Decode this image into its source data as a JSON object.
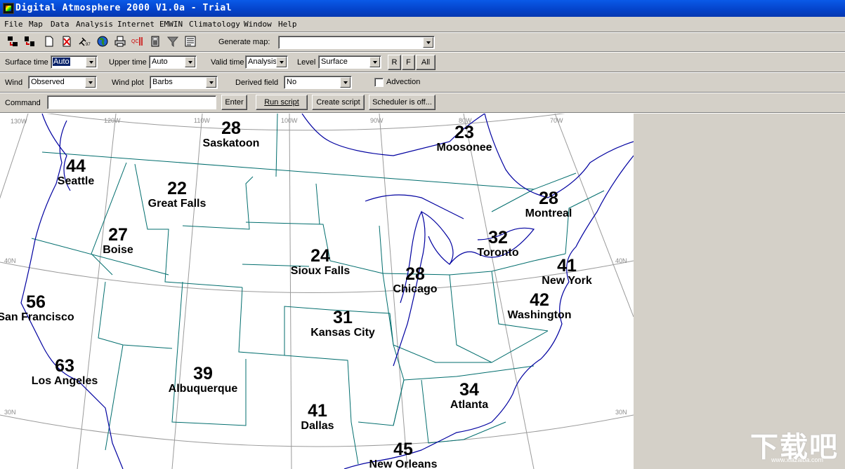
{
  "window": {
    "title": "Digital Atmosphere 2000 V1.0a - Trial"
  },
  "menu": [
    "File",
    "Map",
    "Data",
    "Analysis",
    "Internet",
    "EMWIN",
    "Climatology",
    "Window",
    "Help"
  ],
  "toolbar": {
    "icons": [
      "tile-horizontal-icon",
      "tile-vertical-icon",
      "new-map-icon",
      "delete-icon",
      "satellite-icon",
      "globe-icon",
      "print-icon",
      "radar-icon",
      "calculator-icon",
      "filter-icon",
      "report-icon"
    ],
    "generate_map_label": "Generate map:",
    "generate_map_value": ""
  },
  "row1": {
    "surface_time_label": "Surface time",
    "surface_time_value": "Auto",
    "upper_time_label": "Upper time",
    "upper_time_value": "Auto",
    "valid_time_label": "Valid time",
    "valid_time_value": "Analysis",
    "level_label": "Level",
    "level_value": "Surface",
    "btn_r": "R",
    "btn_f": "F",
    "btn_all": "All"
  },
  "row2": {
    "wind_label": "Wind",
    "wind_value": "Observed",
    "wind_plot_label": "Wind plot",
    "wind_plot_value": "Barbs",
    "derived_field_label": "Derived field",
    "derived_field_value": "No",
    "advection_label": "Advection",
    "advection_checked": false
  },
  "row3": {
    "command_label": "Command",
    "command_value": "",
    "enter_label": "Enter",
    "run_script_label": "Run script",
    "create_script_label": "Create script",
    "scheduler_label": "Scheduler is off..."
  },
  "map": {
    "colors": {
      "coast": "#0000a0",
      "state_border": "#006d6d",
      "grid": "#9a9a9a",
      "background": "#ffffff"
    },
    "longitudes": [
      "130W",
      "120W",
      "110W",
      "100W",
      "90W",
      "80W",
      "70W"
    ],
    "latitudes": [
      "40N",
      "40N",
      "30N",
      "30N"
    ],
    "cities": [
      {
        "name": "Saskatoon",
        "temp": "28"
      },
      {
        "name": "Moosonee",
        "temp": "23"
      },
      {
        "name": "Seattle",
        "temp": "44"
      },
      {
        "name": "Great Falls",
        "temp": "22"
      },
      {
        "name": "Montreal",
        "temp": "28"
      },
      {
        "name": "Boise",
        "temp": "27"
      },
      {
        "name": "Toronto",
        "temp": "32"
      },
      {
        "name": "Sioux Falls",
        "temp": "24"
      },
      {
        "name": "Chicago",
        "temp": "28"
      },
      {
        "name": "New York",
        "temp": "41"
      },
      {
        "name": "San Francisco",
        "temp": "56"
      },
      {
        "name": "Washington",
        "temp": "42"
      },
      {
        "name": "Kansas City",
        "temp": "31"
      },
      {
        "name": "Los Angeles",
        "temp": "63"
      },
      {
        "name": "Albuquerque",
        "temp": "39"
      },
      {
        "name": "Atlanta",
        "temp": "34"
      },
      {
        "name": "Dallas",
        "temp": "41"
      },
      {
        "name": "New Orleans",
        "temp": "45"
      }
    ]
  },
  "watermark": {
    "text": "下载吧",
    "url": "www.xiazaiba.com"
  }
}
